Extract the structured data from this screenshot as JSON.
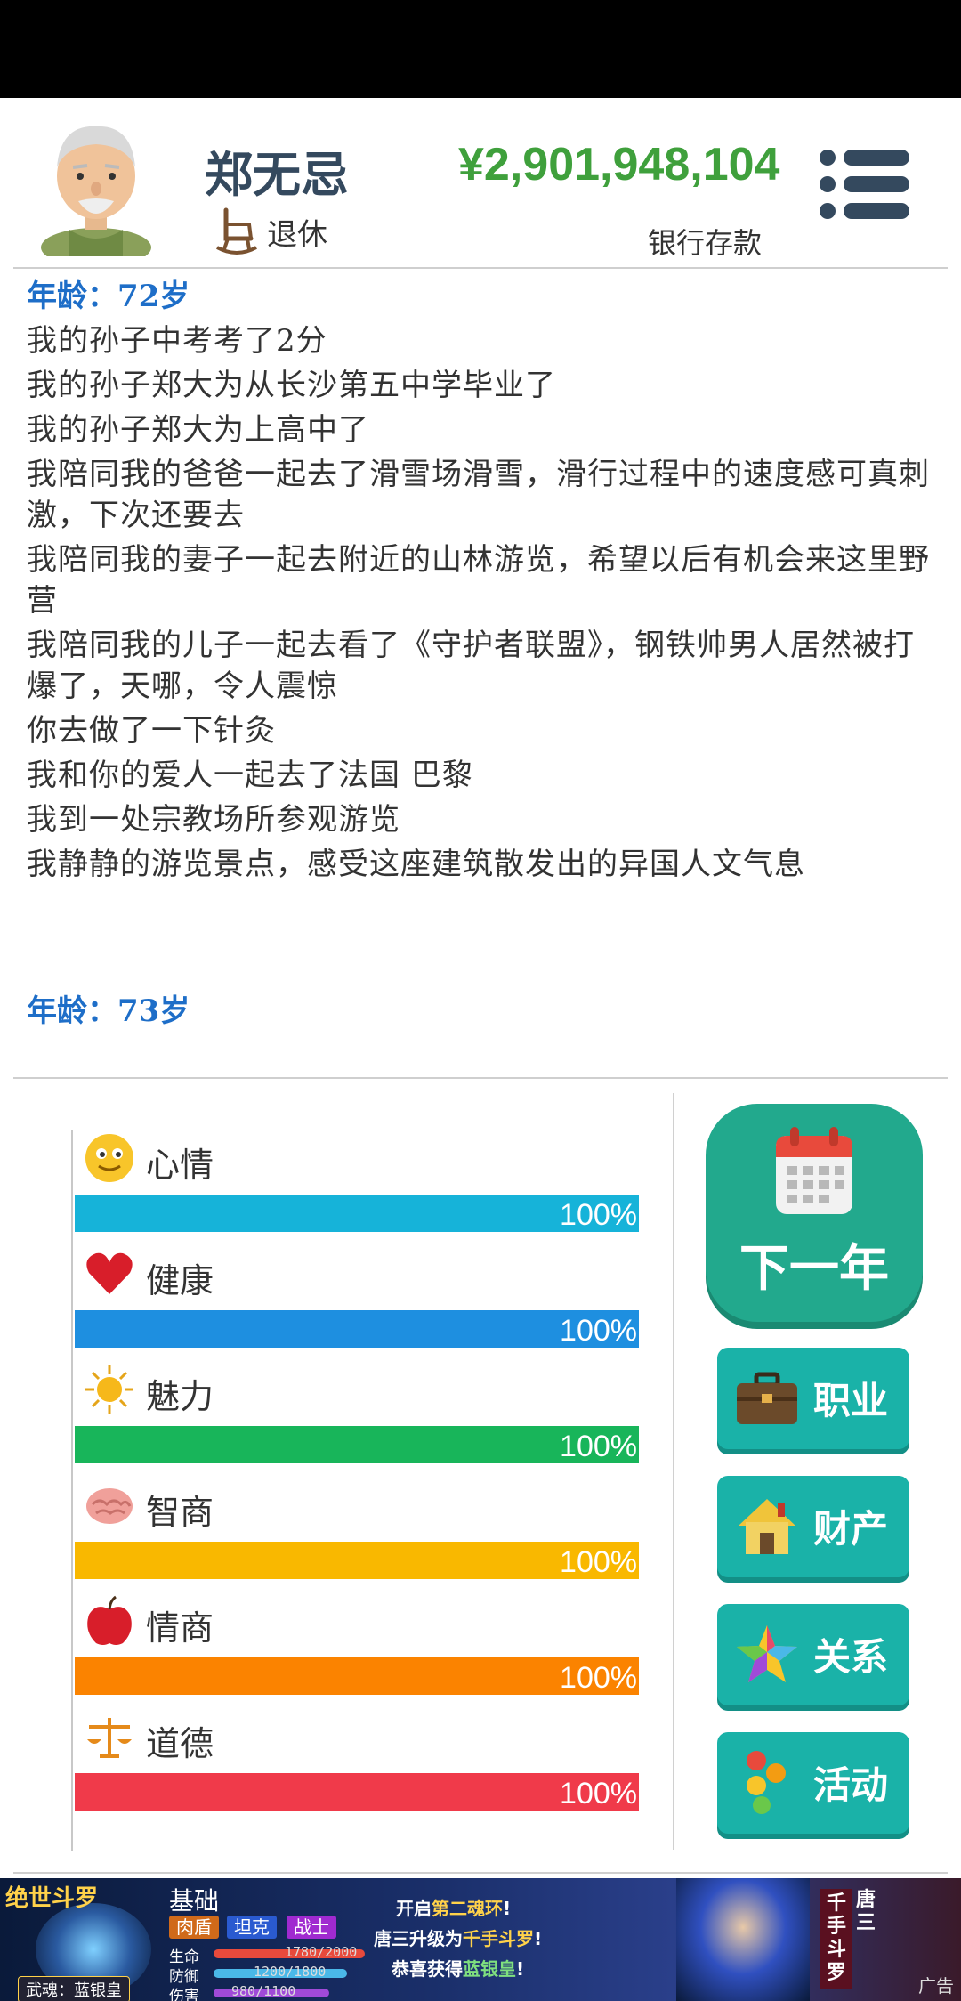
{
  "header": {
    "name": "郑无忌",
    "job_label": "退休",
    "money": "¥2,901,948,104",
    "money_label": "银行存款"
  },
  "log": {
    "age_current": "年龄：72岁",
    "entries": [
      "我的孙子中考考了2分",
      "我的孙子郑大为从长沙第五中学毕业了",
      "我的孙子郑大为上高中了",
      "我陪同我的爸爸一起去了滑雪场滑雪，滑行过程中的速度感可真刺激，下次还要去",
      "我陪同我的妻子一起去附近的山林游览，希望以后有机会来这里野营",
      "我陪同我的儿子一起去看了《守护者联盟》，钢铁帅男人居然被打爆了，天哪，令人震惊",
      "你去做了一下针灸",
      "我和你的爱人一起去了法国 巴黎",
      "我到一处宗教场所参观游览",
      "我静静的游览景点，感受这座建筑散发出的异国人文气息"
    ],
    "age_next": "年龄：73岁"
  },
  "stats": [
    {
      "name": "心情",
      "value": "100%",
      "level": 1.0,
      "color": "#16b3d9",
      "icon": "smiley-icon"
    },
    {
      "name": "健康",
      "value": "100%",
      "level": 1.0,
      "color": "#1e8fe0",
      "icon": "heart-icon"
    },
    {
      "name": "魅力",
      "value": "100%",
      "level": 1.0,
      "color": "#18b55a",
      "icon": "sun-icon"
    },
    {
      "name": "智商",
      "value": "100%",
      "level": 1.0,
      "color": "#f9b800",
      "icon": "brain-icon"
    },
    {
      "name": "情商",
      "value": "100%",
      "level": 1.0,
      "color": "#fb8300",
      "icon": "apple-icon"
    },
    {
      "name": "道德",
      "value": "100%",
      "level": 1.0,
      "color": "#f03a4a",
      "icon": "scales-icon"
    }
  ],
  "buttons": {
    "next_year": "下一年",
    "career": "职业",
    "property": "财产",
    "relations": "关系",
    "activities": "活动"
  },
  "ad": {
    "logo": "绝世斗罗",
    "hero_tag": "武魂：蓝银皇",
    "title": "基础",
    "tags": [
      "肉盾",
      "坦克",
      "战士"
    ],
    "stat_labels": [
      "生命",
      "防御",
      "伤害"
    ],
    "stat_values": [
      "1780/2000",
      "1200/1800",
      "980/1100"
    ],
    "line1_a": "开启",
    "line1_b": "第二魂环",
    "line1_c": "!",
    "line2_a": "唐三升级为",
    "line2_b": "千手斗罗",
    "line2_c": "!",
    "line3_a": "恭喜获得",
    "line3_b": "蓝银皇",
    "line3_c": "!",
    "vertical_1": "千手斗罗",
    "vertical_2": "唐三",
    "close_label": "广告"
  },
  "colors": {
    "accent_blue": "#1e6ec8",
    "money_green": "#3fa03c",
    "button_green": "#22a98d",
    "button_teal": "#1ab2a8"
  }
}
